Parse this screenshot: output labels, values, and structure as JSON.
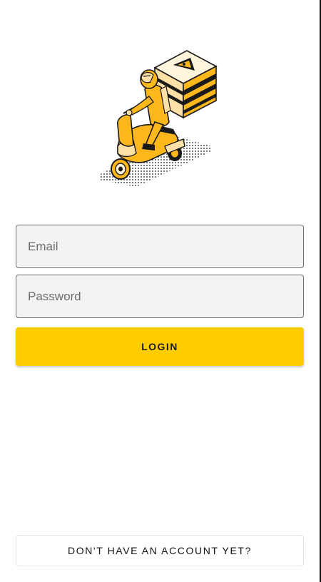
{
  "illustration": {
    "name": "delivery-scooter-illustration",
    "colors": {
      "primary": "#ffb81c",
      "light": "#ffe0a6",
      "cream": "#fff4dc",
      "outline": "#1a1a1a"
    }
  },
  "form": {
    "email": {
      "placeholder": "Email",
      "value": ""
    },
    "password": {
      "placeholder": "Password",
      "value": ""
    },
    "login_label": "LOGIN"
  },
  "footer": {
    "signup_label": "DON'T HAVE AN ACCOUNT YET?"
  },
  "colors": {
    "accent": "#ffcc00",
    "field_background": "#f3f3f3",
    "field_border": "#6e6e6e",
    "page_background": "#ffffff"
  }
}
